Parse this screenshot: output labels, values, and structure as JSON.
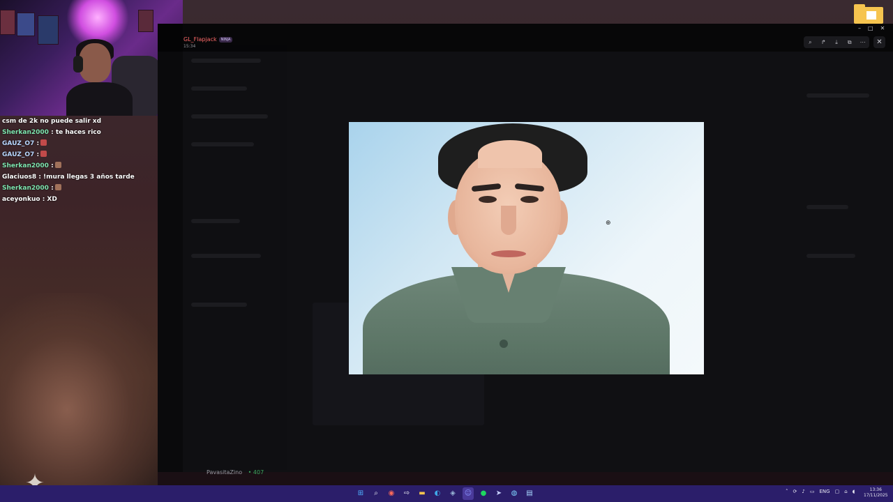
{
  "stream": {
    "chat_messages": [
      {
        "user": "",
        "text": "csm de 2k no puede salir xd",
        "user_color": "#ffffff",
        "emote_color": ""
      },
      {
        "user": "Sherkan2000",
        "text": ": te haces rico",
        "user_color": "#7fe6b0",
        "emote_color": ""
      },
      {
        "user": "GAUZ_O7",
        "text": ":",
        "user_color": "#b9d7ff",
        "emote_color": "#c24a4a"
      },
      {
        "user": "GAUZ_O7",
        "text": ":",
        "user_color": "#b9d7ff",
        "emote_color": "#c24a4a"
      },
      {
        "user": "Sherkan2000",
        "text": ":",
        "user_color": "#7fe6b0",
        "emote_color": "#a0715a"
      },
      {
        "user": "Glaciuos8",
        "text": ": !mura llegas 3 años tarde",
        "user_color": "#ffffff",
        "emote_color": ""
      },
      {
        "user": "Sherkan2000",
        "text": ":",
        "user_color": "#7fe6b0",
        "emote_color": "#a0715a"
      },
      {
        "user": "aceyonkuo",
        "text": ": XD",
        "user_color": "#ffffff",
        "emote_color": ""
      }
    ]
  },
  "viewer": {
    "username": "GL_Flapjack",
    "badge": "NINJA",
    "time": "15:34",
    "tools": [
      "zoom-icon",
      "share-icon",
      "download-icon",
      "open-icon",
      "more-icon"
    ],
    "close_label": "✕"
  },
  "discord": {
    "bottom_user": "PavasitaZino",
    "bottom_count": "• 407"
  },
  "taskbar": {
    "icons": [
      "windows-icon",
      "search-icon",
      "chrome-icon",
      "media-icon",
      "folder-icon",
      "edge-icon",
      "steam-icon",
      "discord-icon",
      "spotify-icon",
      "telegram-icon",
      "browser-icon",
      "notepad-icon"
    ],
    "lang": "ENG",
    "time": "13:36",
    "date": "17/11/2025"
  },
  "colors": {
    "taskbar": "#2b1e6a",
    "username": "#ff6a6a"
  }
}
